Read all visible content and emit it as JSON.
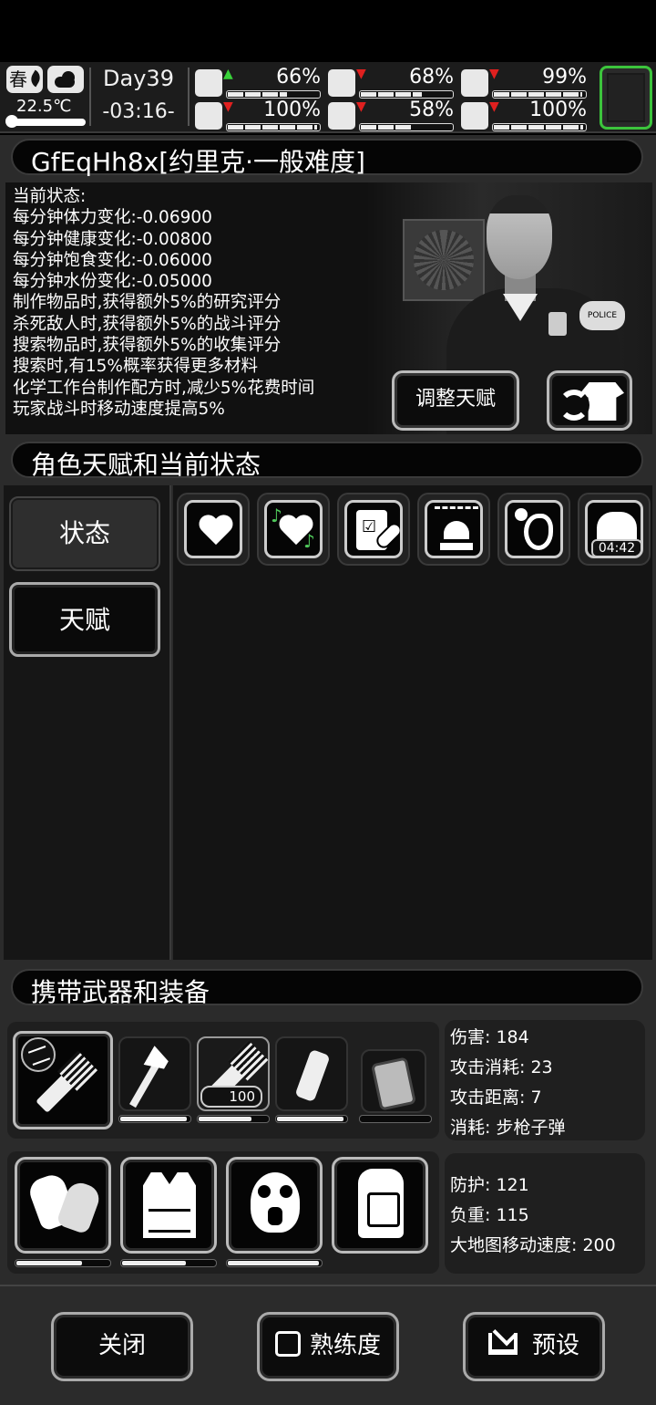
{
  "top": {
    "season": "春",
    "temperature": "22.5℃",
    "day": "Day39",
    "time": "-03:16-",
    "stats": [
      {
        "name": "health",
        "pct": "66%",
        "trend": "up",
        "fill": 0.66
      },
      {
        "name": "hunger",
        "pct": "68%",
        "trend": "down",
        "fill": 0.68
      },
      {
        "name": "mood",
        "pct": "99%",
        "trend": "down",
        "fill": 0.99
      },
      {
        "name": "stamina",
        "pct": "100%",
        "trend": "down",
        "fill": 1.0
      },
      {
        "name": "water",
        "pct": "58%",
        "trend": "down",
        "fill": 0.58
      },
      {
        "name": "heart",
        "pct": "100%",
        "trend": "down",
        "fill": 1.0
      }
    ]
  },
  "character": {
    "title": "GfEqHh8x[约里克·一般难度]",
    "status_lines": [
      "当前状态:",
      "每分钟体力变化:-0.06900",
      "每分钟健康变化:-0.00800",
      "每分钟饱食变化:-0.06000",
      "每分钟水份变化:-0.05000",
      "制作物品时,获得额外5%的研究评分",
      "杀死敌人时,获得额外5%的战斗评分",
      "搜索物品时,获得额外5%的收集评分",
      "搜索时,有15%概率获得更多材料",
      "化学工作台制作配方时,减少5%花费时间",
      "玩家战斗时移动速度提高5%"
    ],
    "adjust_button": "调整天赋",
    "patch_text": "POLICE"
  },
  "talent": {
    "header": "角色天赋和当前状态",
    "tabs": [
      "状态",
      "天赋"
    ],
    "active_tab": "状态",
    "status_icons": [
      "heart-icon",
      "music-heart-icon",
      "clipboard-pill-icon",
      "siren-icon",
      "stomach-icon",
      "wet-clothes-icon"
    ],
    "timer": "04:42"
  },
  "equipment": {
    "header": "携带武器和装备",
    "weapons": [
      {
        "name": "minigun",
        "durability": null
      },
      {
        "name": "axe",
        "durability": 0.99
      },
      {
        "name": "minigun",
        "durability": 0.78,
        "ammo": "100"
      },
      {
        "name": "smoke-grenade",
        "durability": 0.98
      },
      {
        "name": "riot-shield",
        "durability": 0
      }
    ],
    "weapon_stats": [
      "伤害: 184",
      "攻击消耗: 23",
      "攻击距离: 7",
      "消耗: 步枪子弹"
    ],
    "armor": [
      {
        "name": "gloves",
        "durability": 0.72
      },
      {
        "name": "vest",
        "durability": 0.7
      },
      {
        "name": "gas-mask",
        "durability": 1.0
      },
      {
        "name": "backpack",
        "durability": null
      }
    ],
    "armor_stats": [
      "防护: 121",
      "负重: 115",
      "大地图移动速度: 200"
    ]
  },
  "bottom": {
    "close": "关闭",
    "proficiency": "熟练度",
    "preset": "预设"
  }
}
